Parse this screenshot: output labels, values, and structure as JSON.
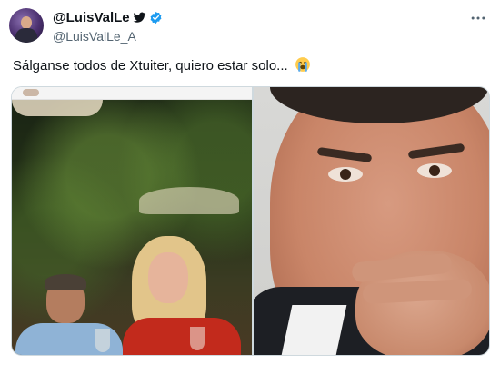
{
  "tweet": {
    "display_name": "@LuisValLe",
    "handle": "@LuisValLe_A",
    "text": "Sálganse todos de Xtuiter, quiero estar solo...",
    "icons": {
      "bird": "twitter-bird-icon",
      "verified": "verified-badge-icon",
      "more": "more-options-icon",
      "emoji": "loudly-crying-face-emoji"
    },
    "colors": {
      "verified": "#1d9bf0",
      "text": "#0f1419",
      "secondary": "#536471",
      "border": "#cfd9de"
    }
  }
}
